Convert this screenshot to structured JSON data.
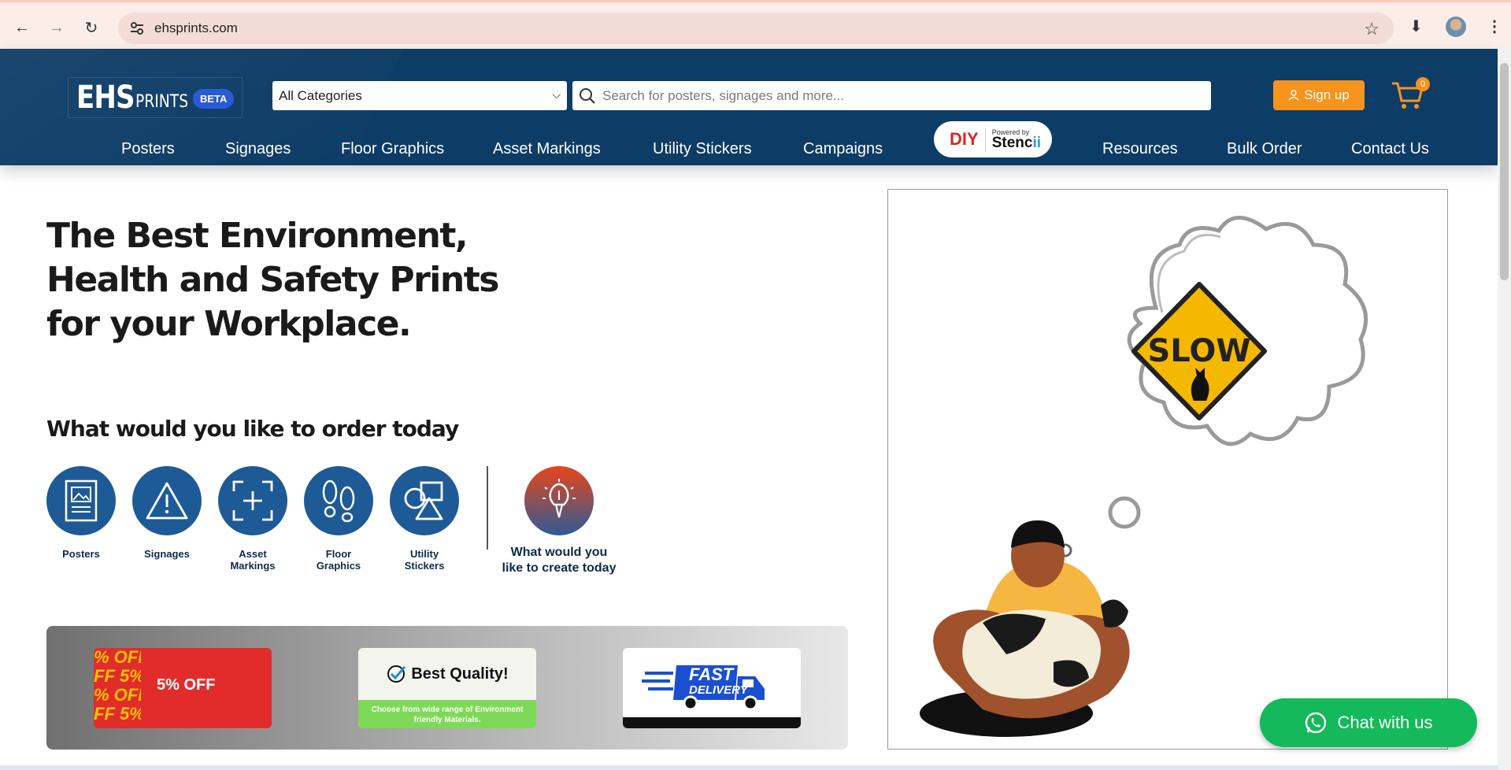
{
  "browser": {
    "url": "ehsprints.com",
    "icons": [
      "back-icon",
      "forward-icon",
      "reload-icon",
      "site-info-icon",
      "bookmark-star-icon",
      "download-icon",
      "profile-avatar",
      "menu-dots-icon"
    ]
  },
  "header": {
    "logo_main": "EHS",
    "logo_sub": "PRINTS",
    "logo_badge": "BETA",
    "category_select": "All Categories",
    "search_placeholder": "Search for posters, signages and more...",
    "signup_label": "Sign up",
    "cart_count": "0"
  },
  "nav": {
    "items": [
      "Posters",
      "Signages",
      "Floor Graphics",
      "Asset Markings",
      "Utility Stickers",
      "Campaigns",
      "Resources",
      "Bulk Order",
      "Contact Us"
    ],
    "diy": {
      "label": "DIY",
      "powered": "Powered by",
      "brand_a": "Stenc",
      "brand_b": "ii"
    }
  },
  "hero": {
    "title": "The Best Environment, Health and Safety Prints for your Workplace."
  },
  "order": {
    "title": "What would you like to order today",
    "categories": [
      {
        "label": "Posters",
        "icon": "poster-icon"
      },
      {
        "label": "Signages",
        "icon": "warning-icon"
      },
      {
        "label": "Asset Markings",
        "icon": "asset-marking-icon"
      },
      {
        "label": "Floor Graphics",
        "icon": "footprints-icon"
      },
      {
        "label": "Utility Stickers",
        "icon": "shapes-icon"
      }
    ],
    "create_label": "What would you like to create today"
  },
  "banner": {
    "card1": "5% OFF",
    "card1_stripe": "% OFF\nFF 5%\n% OFF\nFF 5%",
    "card2_title": "Best Quality!",
    "card2_sub": "Choose from wide range of Environment friendly Materials.",
    "card3_line1": "FAST",
    "card3_line2": "DELIVERY"
  },
  "illustration": {
    "sign_text": "SLOW"
  },
  "chat": {
    "label": "Chat with us"
  },
  "colors": {
    "header_bg": "#0d3c66",
    "accent_orange": "#f7941d",
    "chat_green": "#13b95a",
    "icon_blue": "#1e5a96"
  }
}
